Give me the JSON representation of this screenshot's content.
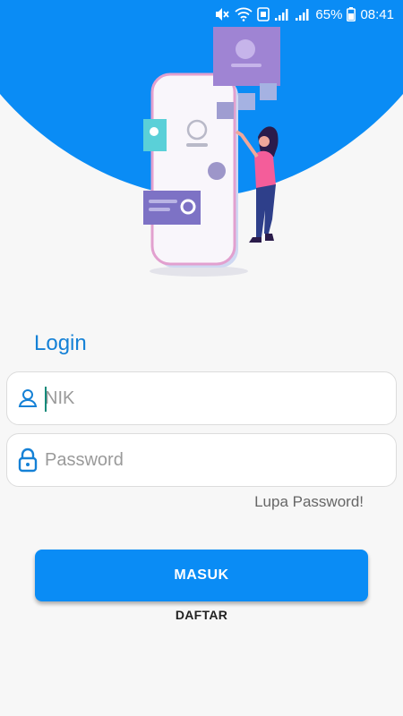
{
  "status_bar": {
    "battery_percent": "65%",
    "time": "08:41",
    "icons": [
      "mute-icon",
      "wifi-icon",
      "nfc-icon",
      "signal-icon",
      "signal-icon",
      "battery-icon"
    ]
  },
  "colors": {
    "brand_blue": "#0a8cf5",
    "title_blue": "#1581d6",
    "background": "#f7f7f7"
  },
  "login": {
    "title": "Login",
    "nik_placeholder": "NIK",
    "password_placeholder": "Password",
    "forgot_password": "Lupa Password!",
    "submit_label": "MASUK",
    "register_label": "DAFTAR"
  }
}
